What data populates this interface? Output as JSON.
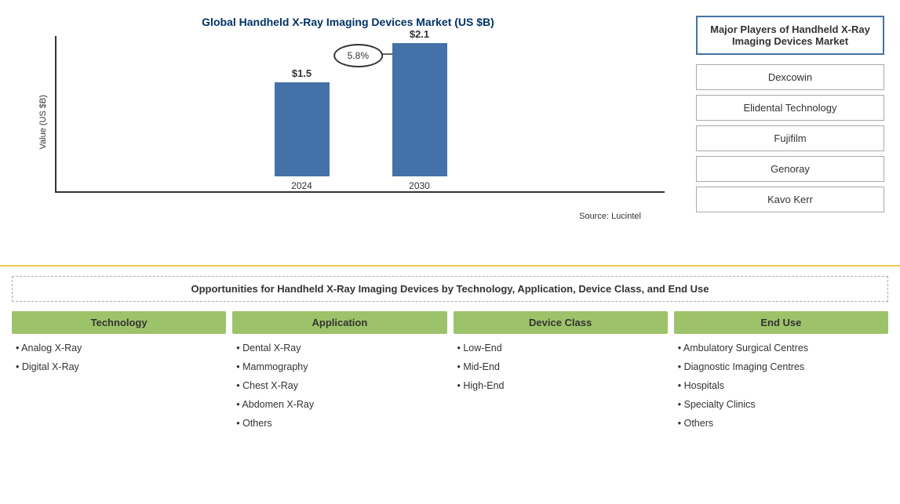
{
  "chart": {
    "title": "Global Handheld X-Ray Imaging Devices Market (US $B)",
    "y_axis_label": "Value (US $B)",
    "bar_2024": {
      "year": "2024",
      "value": "$1.5",
      "height": 120
    },
    "bar_2030": {
      "year": "2030",
      "value": "$2.1",
      "height": 170
    },
    "cagr_label": "5.8%",
    "source": "Source: Lucintel"
  },
  "major_players": {
    "title_line1": "Major Players of Handheld X-Ray",
    "title_line2": "Imaging Devices Market",
    "players": [
      "Dexcowin",
      "Elidental Technology",
      "Fujifilm",
      "Genoray",
      "Kavo Kerr"
    ]
  },
  "opportunities": {
    "title": "Opportunities for Handheld X-Ray Imaging Devices by Technology, Application, Device Class, and End Use",
    "categories": [
      {
        "header": "Technology",
        "items": [
          "Analog X-Ray",
          "Digital X-Ray"
        ]
      },
      {
        "header": "Application",
        "items": [
          "Dental X-Ray",
          "Mammography",
          "Chest X-Ray",
          "Abdomen X-Ray",
          "Others"
        ]
      },
      {
        "header": "Device Class",
        "items": [
          "Low-End",
          "Mid-End",
          "High-End"
        ]
      },
      {
        "header": "End Use",
        "items": [
          "Ambulatory Surgical Centres",
          "Diagnostic Imaging Centres",
          "Hospitals",
          "Specialty Clinics",
          "Others"
        ]
      }
    ]
  }
}
